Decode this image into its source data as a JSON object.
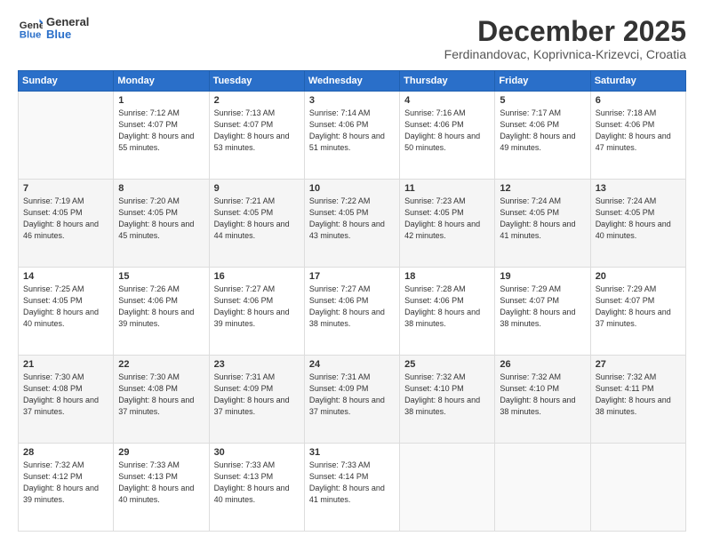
{
  "header": {
    "logo_line1": "General",
    "logo_line2": "Blue",
    "month": "December 2025",
    "location": "Ferdinandovac, Koprivnica-Krizevci, Croatia"
  },
  "weekdays": [
    "Sunday",
    "Monday",
    "Tuesday",
    "Wednesday",
    "Thursday",
    "Friday",
    "Saturday"
  ],
  "rows": [
    [
      {
        "day": "",
        "sunrise": "",
        "sunset": "",
        "daylight": "",
        "empty": true
      },
      {
        "day": "1",
        "sunrise": "7:12 AM",
        "sunset": "4:07 PM",
        "daylight": "8 hours and 55 minutes."
      },
      {
        "day": "2",
        "sunrise": "7:13 AM",
        "sunset": "4:07 PM",
        "daylight": "8 hours and 53 minutes."
      },
      {
        "day": "3",
        "sunrise": "7:14 AM",
        "sunset": "4:06 PM",
        "daylight": "8 hours and 51 minutes."
      },
      {
        "day": "4",
        "sunrise": "7:16 AM",
        "sunset": "4:06 PM",
        "daylight": "8 hours and 50 minutes."
      },
      {
        "day": "5",
        "sunrise": "7:17 AM",
        "sunset": "4:06 PM",
        "daylight": "8 hours and 49 minutes."
      },
      {
        "day": "6",
        "sunrise": "7:18 AM",
        "sunset": "4:06 PM",
        "daylight": "8 hours and 47 minutes."
      }
    ],
    [
      {
        "day": "7",
        "sunrise": "7:19 AM",
        "sunset": "4:05 PM",
        "daylight": "8 hours and 46 minutes."
      },
      {
        "day": "8",
        "sunrise": "7:20 AM",
        "sunset": "4:05 PM",
        "daylight": "8 hours and 45 minutes."
      },
      {
        "day": "9",
        "sunrise": "7:21 AM",
        "sunset": "4:05 PM",
        "daylight": "8 hours and 44 minutes."
      },
      {
        "day": "10",
        "sunrise": "7:22 AM",
        "sunset": "4:05 PM",
        "daylight": "8 hours and 43 minutes."
      },
      {
        "day": "11",
        "sunrise": "7:23 AM",
        "sunset": "4:05 PM",
        "daylight": "8 hours and 42 minutes."
      },
      {
        "day": "12",
        "sunrise": "7:24 AM",
        "sunset": "4:05 PM",
        "daylight": "8 hours and 41 minutes."
      },
      {
        "day": "13",
        "sunrise": "7:24 AM",
        "sunset": "4:05 PM",
        "daylight": "8 hours and 40 minutes."
      }
    ],
    [
      {
        "day": "14",
        "sunrise": "7:25 AM",
        "sunset": "4:05 PM",
        "daylight": "8 hours and 40 minutes."
      },
      {
        "day": "15",
        "sunrise": "7:26 AM",
        "sunset": "4:06 PM",
        "daylight": "8 hours and 39 minutes."
      },
      {
        "day": "16",
        "sunrise": "7:27 AM",
        "sunset": "4:06 PM",
        "daylight": "8 hours and 39 minutes."
      },
      {
        "day": "17",
        "sunrise": "7:27 AM",
        "sunset": "4:06 PM",
        "daylight": "8 hours and 38 minutes."
      },
      {
        "day": "18",
        "sunrise": "7:28 AM",
        "sunset": "4:06 PM",
        "daylight": "8 hours and 38 minutes."
      },
      {
        "day": "19",
        "sunrise": "7:29 AM",
        "sunset": "4:07 PM",
        "daylight": "8 hours and 38 minutes."
      },
      {
        "day": "20",
        "sunrise": "7:29 AM",
        "sunset": "4:07 PM",
        "daylight": "8 hours and 37 minutes."
      }
    ],
    [
      {
        "day": "21",
        "sunrise": "7:30 AM",
        "sunset": "4:08 PM",
        "daylight": "8 hours and 37 minutes."
      },
      {
        "day": "22",
        "sunrise": "7:30 AM",
        "sunset": "4:08 PM",
        "daylight": "8 hours and 37 minutes."
      },
      {
        "day": "23",
        "sunrise": "7:31 AM",
        "sunset": "4:09 PM",
        "daylight": "8 hours and 37 minutes."
      },
      {
        "day": "24",
        "sunrise": "7:31 AM",
        "sunset": "4:09 PM",
        "daylight": "8 hours and 37 minutes."
      },
      {
        "day": "25",
        "sunrise": "7:32 AM",
        "sunset": "4:10 PM",
        "daylight": "8 hours and 38 minutes."
      },
      {
        "day": "26",
        "sunrise": "7:32 AM",
        "sunset": "4:10 PM",
        "daylight": "8 hours and 38 minutes."
      },
      {
        "day": "27",
        "sunrise": "7:32 AM",
        "sunset": "4:11 PM",
        "daylight": "8 hours and 38 minutes."
      }
    ],
    [
      {
        "day": "28",
        "sunrise": "7:32 AM",
        "sunset": "4:12 PM",
        "daylight": "8 hours and 39 minutes."
      },
      {
        "day": "29",
        "sunrise": "7:33 AM",
        "sunset": "4:13 PM",
        "daylight": "8 hours and 40 minutes."
      },
      {
        "day": "30",
        "sunrise": "7:33 AM",
        "sunset": "4:13 PM",
        "daylight": "8 hours and 40 minutes."
      },
      {
        "day": "31",
        "sunrise": "7:33 AM",
        "sunset": "4:14 PM",
        "daylight": "8 hours and 41 minutes."
      },
      {
        "day": "",
        "sunrise": "",
        "sunset": "",
        "daylight": "",
        "empty": true
      },
      {
        "day": "",
        "sunrise": "",
        "sunset": "",
        "daylight": "",
        "empty": true
      },
      {
        "day": "",
        "sunrise": "",
        "sunset": "",
        "daylight": "",
        "empty": true
      }
    ]
  ]
}
